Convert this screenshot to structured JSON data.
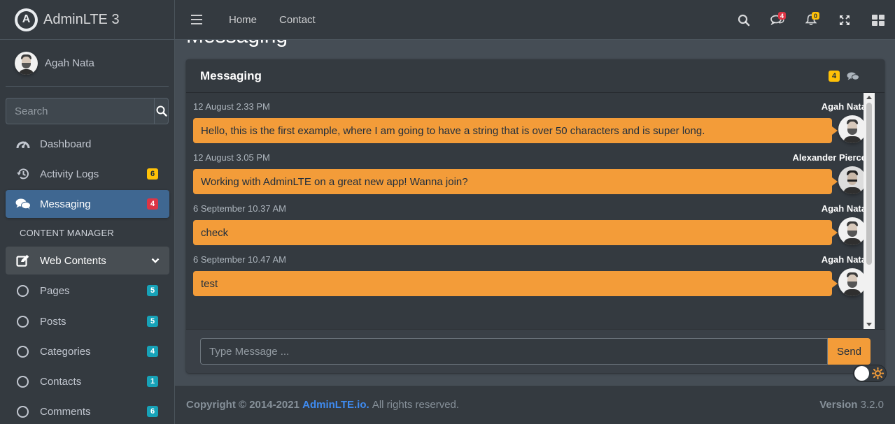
{
  "brand": {
    "name": "AdminLTE 3",
    "logo_letter": "A"
  },
  "user": {
    "name": "Agah Nata"
  },
  "sidebar_search": {
    "placeholder": "Search"
  },
  "nav": {
    "items": [
      {
        "label": "Dashboard",
        "icon": "tachometer-icon"
      },
      {
        "label": "Activity Logs",
        "icon": "history-icon",
        "badge": "6",
        "badge_color": "#ffc107"
      },
      {
        "label": "Messaging",
        "icon": "comments-icon",
        "badge": "4",
        "badge_color": "#dc3545",
        "active": true
      }
    ],
    "header": "CONTENT MANAGER",
    "group": {
      "label": "Web Contents",
      "icon": "edit-icon",
      "expanded": true
    },
    "sub_items": [
      {
        "label": "Pages",
        "badge": "5"
      },
      {
        "label": "Posts",
        "badge": "5"
      },
      {
        "label": "Categories",
        "badge": "4"
      },
      {
        "label": "Contacts",
        "badge": "1"
      },
      {
        "label": "Comments",
        "badge": "6"
      }
    ]
  },
  "topbar": {
    "links": [
      "Home",
      "Contact"
    ],
    "messages_badge": "4",
    "notifications_badge": "0"
  },
  "page": {
    "title": "Messaging"
  },
  "card": {
    "title": "Messaging",
    "count_badge": "4",
    "messages": [
      {
        "time": "12 August 2.33 PM",
        "name": "Agah Nata",
        "text": "Hello, this is the first example, where I am going to have a string that is over 50 characters and is super long."
      },
      {
        "time": "12 August 3.05 PM",
        "name": "Alexander Pierce",
        "text": "Working with AdminLTE on a great new app! Wanna join?"
      },
      {
        "time": "6 September 10.37 AM",
        "name": "Agah Nata",
        "text": "check"
      },
      {
        "time": "6 September 10.47 AM",
        "name": "Agah Nata",
        "text": "test"
      }
    ],
    "input_placeholder": "Type Message ...",
    "send_label": "Send"
  },
  "footer": {
    "copyright_prefix": "Copyright © 2014-2021",
    "link": "AdminLTE.io.",
    "rights": "All rights reserved.",
    "version_label": "Version",
    "version": "3.2.0"
  },
  "colors": {
    "accent": "#f39c39",
    "active_nav": "#3f6791",
    "link": "#3f8bf0"
  }
}
